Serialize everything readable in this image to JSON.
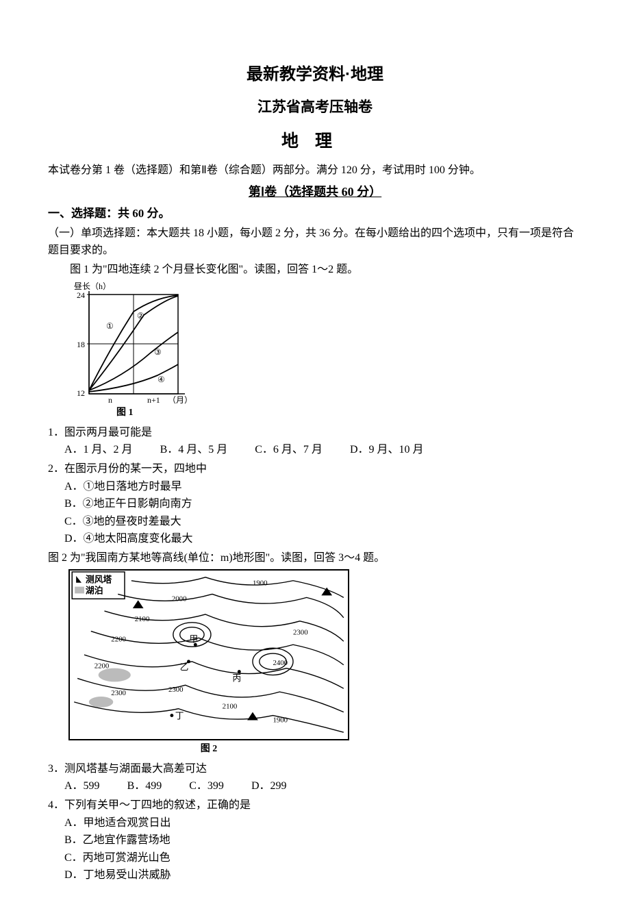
{
  "titles": {
    "main": "最新教学资料·地理",
    "sub": "江苏省高考压轴卷",
    "subject": "地理"
  },
  "intro": "本试卷分第 1 卷（选择题）和第Ⅱ卷（综合题）两部分。满分 120 分，考试用时 100 分钟。",
  "part1_header": "第Ⅰ卷（选择题共 60 分）",
  "section1_label": "一、选择题：共 60 分。",
  "subsection1": "（一）单项选择题：本大题共 18 小题，每小题 2 分，共 36 分。在每小题给出的四个选项中，只有一项是符合题目要求的。",
  "q_intro_1": "图 1 为\"四地连续 2 个月昼长变化图\"。读图，回答 1～2 题。",
  "figure1": {
    "caption": "图 1",
    "ylabel": "昼长（h）",
    "xlabel": "（月）",
    "yticks": [
      "24",
      "18",
      "12"
    ],
    "xticks": [
      "n",
      "n+1"
    ],
    "series": [
      "①",
      "②",
      "③",
      "④"
    ]
  },
  "q1": {
    "stem": "1．图示两月最可能是",
    "opts": {
      "a": "A．1 月、2 月",
      "b": "B．4 月、5 月",
      "c": "C．6 月、7 月",
      "d": "D．9 月、10 月"
    }
  },
  "q2": {
    "stem": "2．在图示月份的某一天，四地中",
    "opts": {
      "a": "A．①地日落地方时最早",
      "b": "B．②地正午日影朝向南方",
      "c": "C．③地的昼夜时差最大",
      "d": "D．④地太阳高度变化最大"
    }
  },
  "q_intro_2": "图 2 为\"我国南方某地等高线(单位：m)地形图\"。读图，回答 3～4 题。",
  "figure2": {
    "caption": "图 2",
    "legend_tower": "测风塔",
    "legend_lake": "湖泊",
    "contour_values": [
      "1900",
      "2000",
      "2100",
      "2200",
      "2300",
      "2400"
    ],
    "points": [
      "甲",
      "乙",
      "丙",
      "丁"
    ]
  },
  "q3": {
    "stem": "3．测风塔基与湖面最大高差可达",
    "opts": {
      "a": "A．599",
      "b": "B．499",
      "c": "C．399",
      "d": "D．299"
    }
  },
  "q4": {
    "stem": "4．下列有关甲～丁四地的叙述，正确的是",
    "opts": {
      "a": "A．甲地适合观赏日出",
      "b": "B．乙地宜作露营场地",
      "c": "C．丙地可赏湖光山色",
      "d": "D．丁地易受山洪威胁"
    }
  }
}
